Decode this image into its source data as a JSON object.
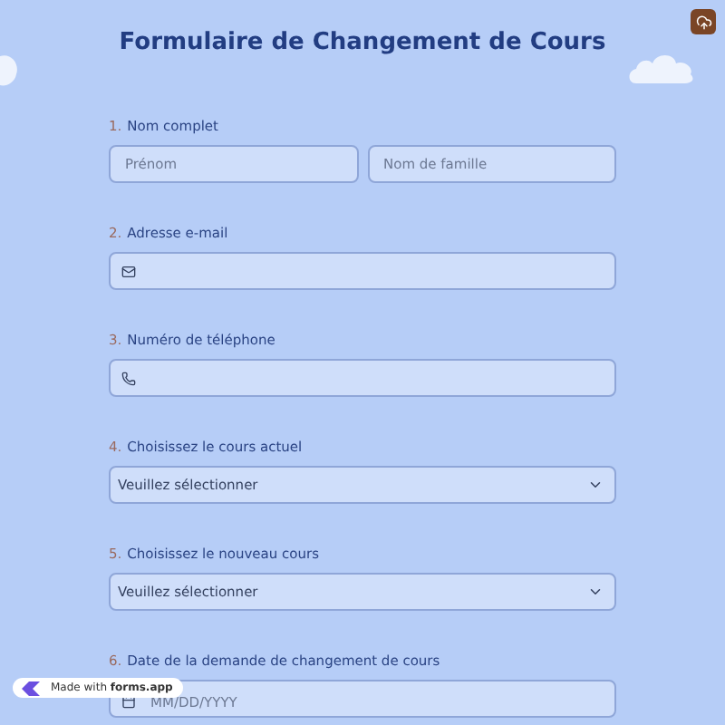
{
  "title": "Formulaire de Changement de Cours",
  "questions": [
    {
      "kind": "name",
      "number": "1.",
      "label": "Nom complet",
      "placeholders": [
        "Prénom",
        "Nom de famille"
      ]
    },
    {
      "kind": "email",
      "number": "2.",
      "label": "Adresse e-mail"
    },
    {
      "kind": "phone",
      "number": "3.",
      "label": "Numéro de téléphone"
    },
    {
      "kind": "select",
      "number": "4.",
      "label": "Choisissez le cours actuel",
      "value": "Veuillez sélectionner"
    },
    {
      "kind": "select",
      "number": "5.",
      "label": "Choisissez le nouveau cours",
      "value": "Veuillez sélectionner"
    },
    {
      "kind": "date",
      "number": "6.",
      "label": "Date de la demande de changement de cours",
      "placeholder": "MM/DD/YYYY"
    }
  ],
  "badge": "Made with **forms.app**"
}
